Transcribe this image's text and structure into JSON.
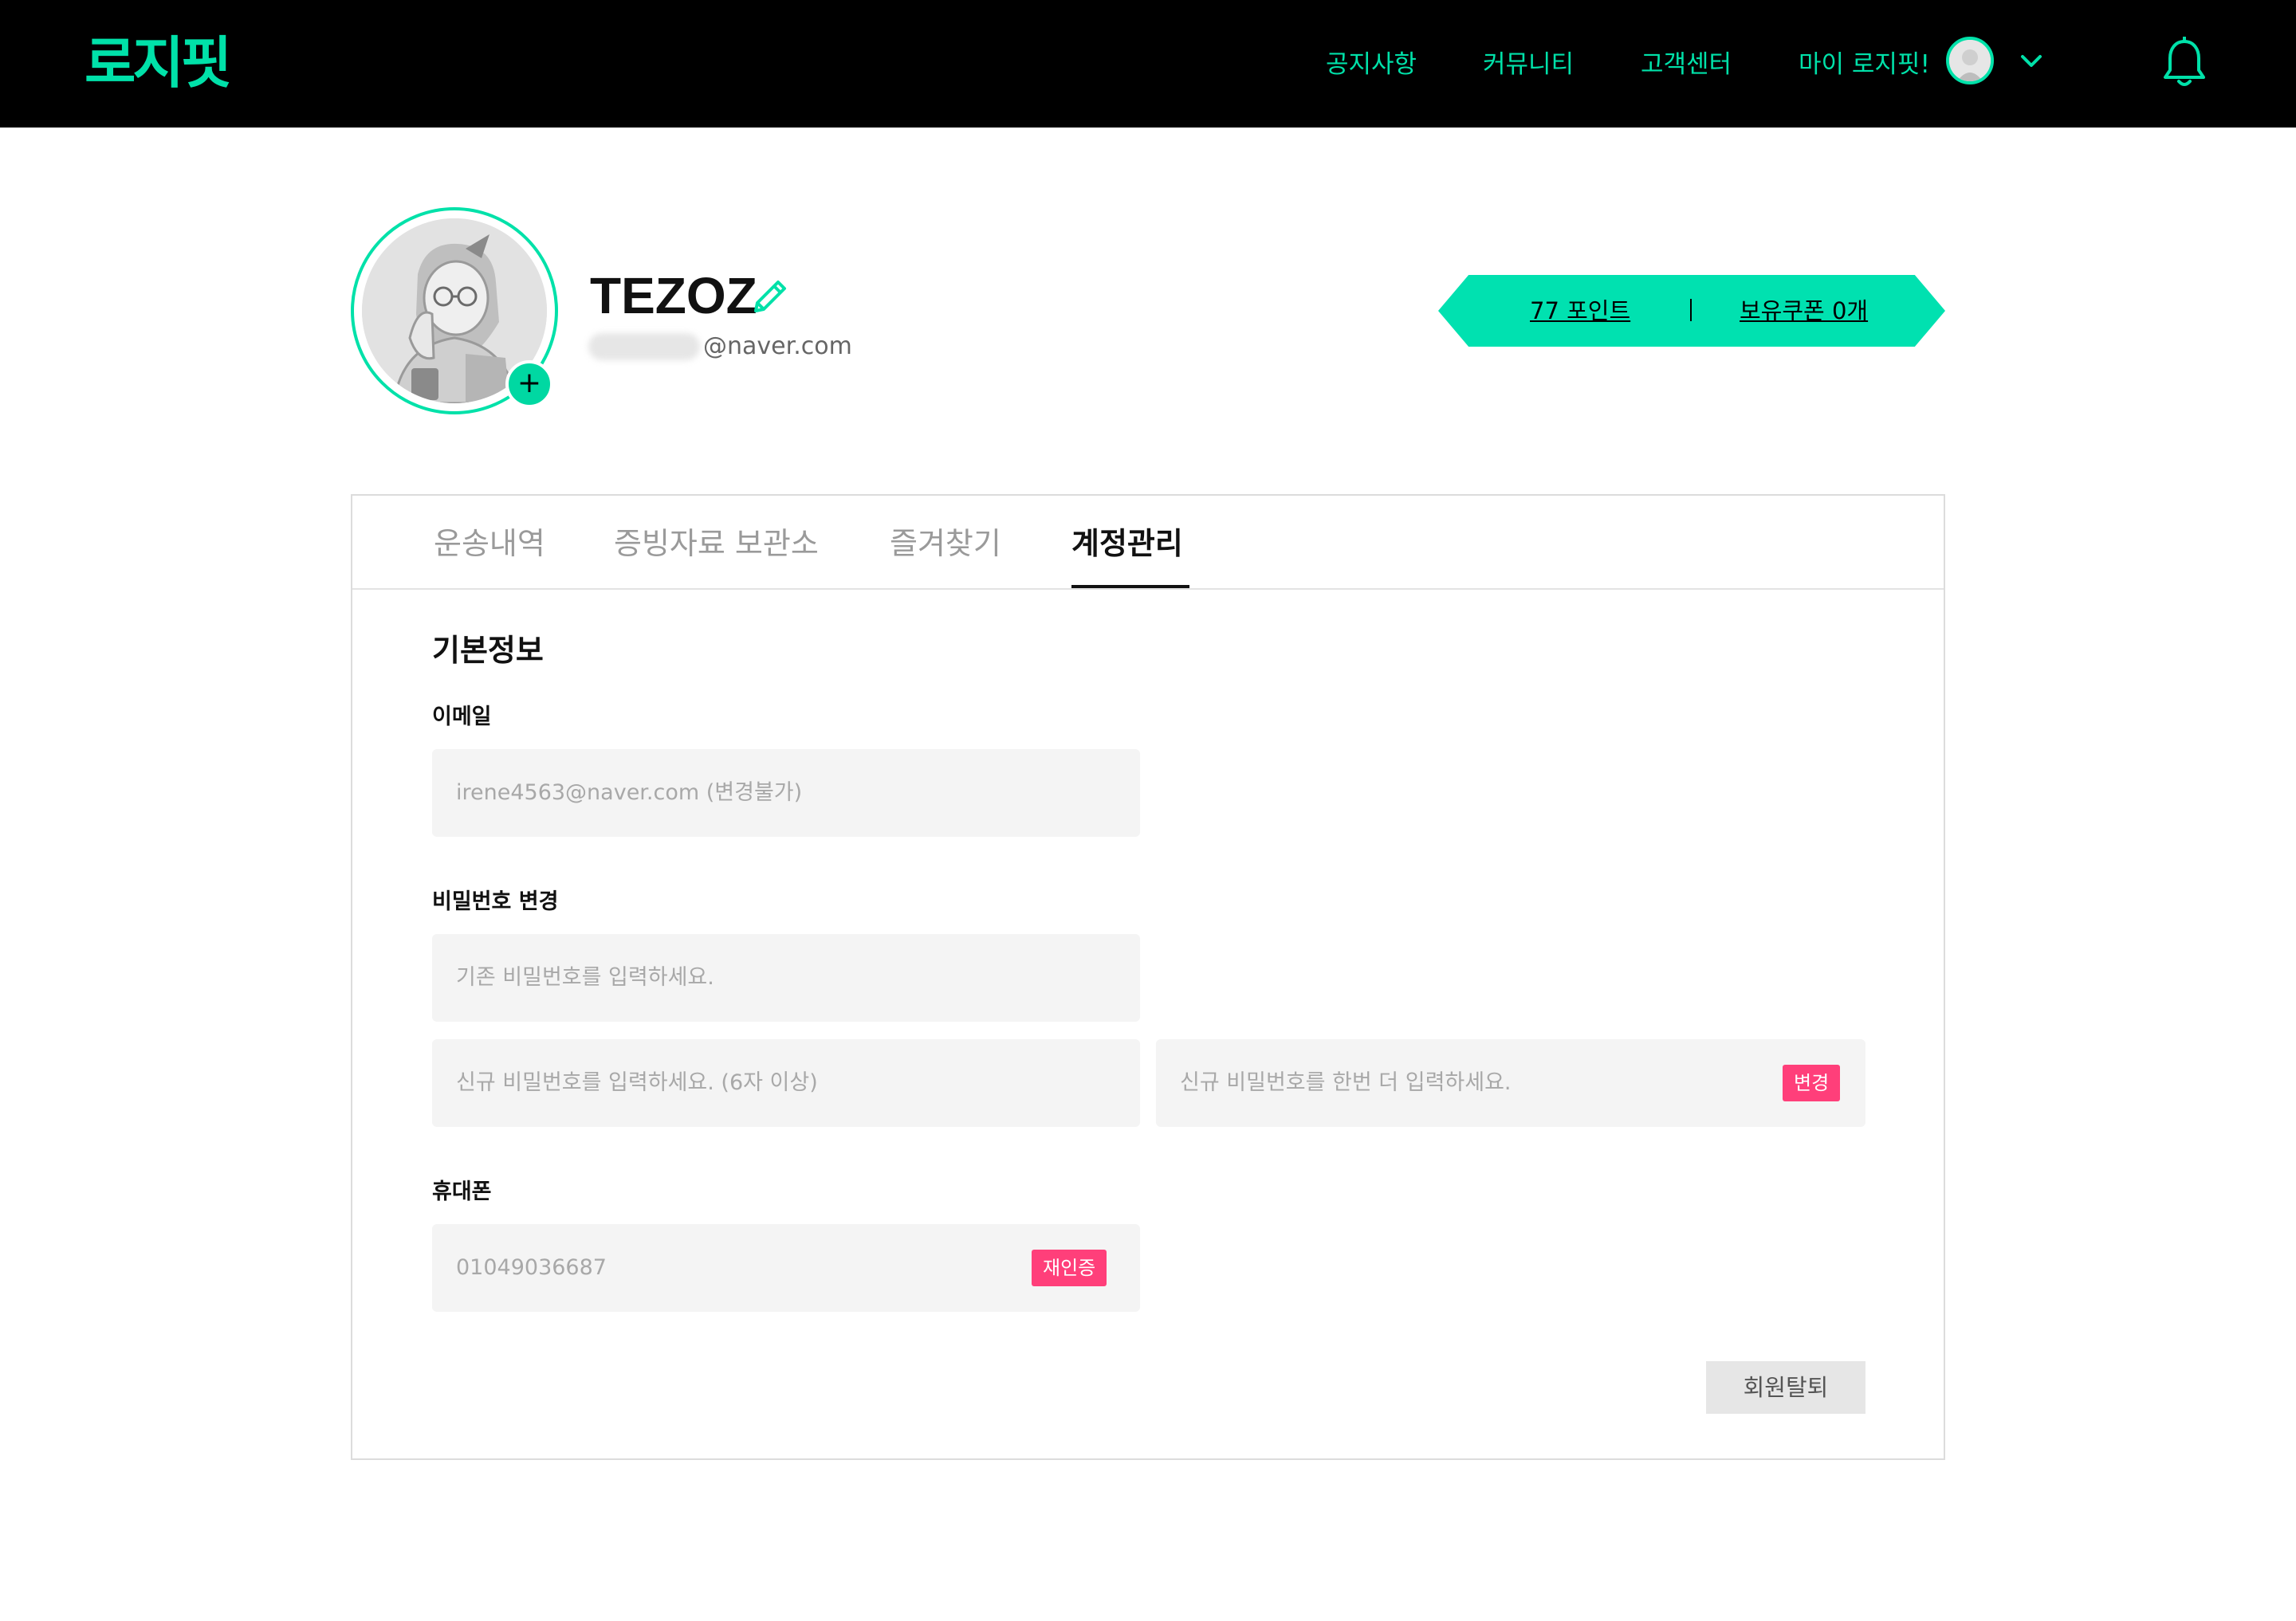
{
  "header": {
    "logo": "로지핏",
    "nav": {
      "notice": "공지사항",
      "community": "커뮤니티",
      "support": "고객센터",
      "my": "마이 로지핏!"
    }
  },
  "profile": {
    "name": "TEZOZ",
    "email_domain": "@naver.com",
    "add_photo": "+",
    "points": "77 포인트",
    "coupons": "보유쿠폰 0개"
  },
  "tabs": [
    "운송내역",
    "증빙자료 보관소",
    "즐겨찾기",
    "계정관리"
  ],
  "active_tab": "계정관리",
  "form": {
    "section_title": "기본정보",
    "email_label": "이메일",
    "email_value": "irene4563@naver.com (변경불가)",
    "password_label": "비밀번호 변경",
    "current_password_placeholder": "기존 비밀번호를 입력하세요.",
    "new_password_placeholder": "신규 비밀번호를 입력하세요. (6자 이상)",
    "confirm_password_placeholder": "신규 비밀번호를 한번 더 입력하세요.",
    "change_button": "변경",
    "phone_label": "휴대폰",
    "phone_value": "01049036687",
    "reverify_button": "재인증",
    "withdraw_button": "회원탈퇴"
  },
  "colors": {
    "accent": "#00e1a9",
    "header_bg": "#000000",
    "pink": "#ff3f7a"
  },
  "icons": [
    "bell-icon",
    "chevron-down-icon",
    "pencil-icon",
    "plus-icon",
    "avatar-illustration"
  ]
}
